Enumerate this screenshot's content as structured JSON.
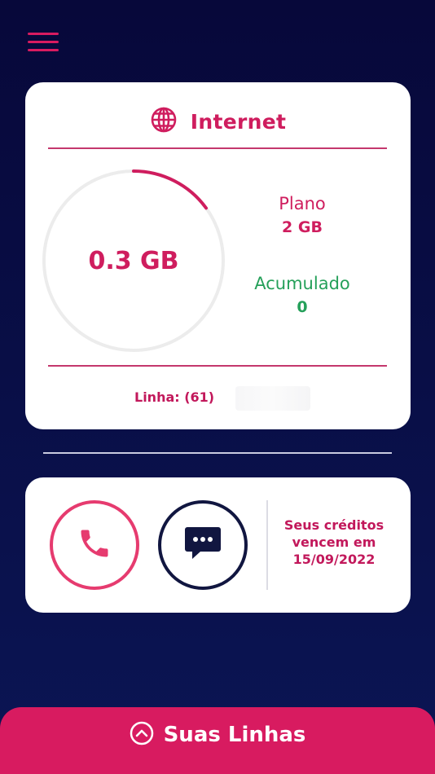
{
  "header": {
    "menu_icon": "hamburger-menu-icon"
  },
  "internet": {
    "title": "Internet",
    "icon": "globe-icon",
    "usage_display": "0.3 GB",
    "usage_fraction": 0.15,
    "plan_label": "Plano",
    "plan_value": "2 GB",
    "accumulated_label": "Acumulado",
    "accumulated_value": "0",
    "line_label": "Linha: (61)"
  },
  "actions": {
    "call_icon": "phone-icon",
    "message_icon": "chat-bubble-icon",
    "credits_text": "Seus créditos vencem em 15/09/2022"
  },
  "bottom_bar": {
    "icon": "chevron-up-circle-icon",
    "label": "Suas Linhas"
  },
  "colors": {
    "background": "#07083a",
    "accent": "#d81b60",
    "accent_text": "#cf1d5e",
    "success": "#25a05a",
    "card": "#ffffff",
    "dark_ring": "#111640",
    "call_ring": "#e63b6f"
  }
}
